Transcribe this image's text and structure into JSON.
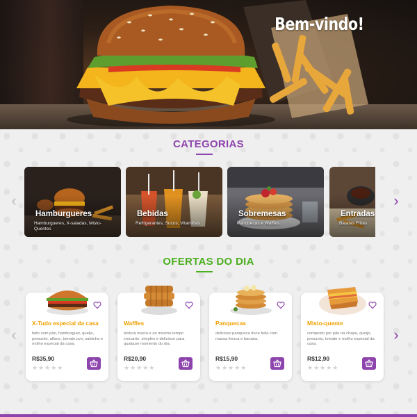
{
  "hero": {
    "title": "Bem-vindo!"
  },
  "categories": {
    "title": "CATEGORIAS",
    "items": [
      {
        "name": "Hamburgueres",
        "desc": "Hamburgueres, X-saladas, Misto-Quentes"
      },
      {
        "name": "Bebidas",
        "desc": "Refrigerantes, Sucos, Vitaminas"
      },
      {
        "name": "Sobremesas",
        "desc": "Panquecas e Waffles"
      },
      {
        "name": "Entradas",
        "desc": "Batatas Fritas"
      }
    ]
  },
  "offers": {
    "title": "OFERTAS DO DIA",
    "items": [
      {
        "title": "X-Tudo especial da casa",
        "desc": "feito com pão, hamburguer, queijo, presunto, alface, tomate,ovo, salsicha e molho especial da casa.",
        "price": "R$35,90"
      },
      {
        "title": "Waffles",
        "desc": "textura macia e ao mesmo tempo crocante. simples e delicioso para qualquer momento do dia.",
        "price": "R$20,90"
      },
      {
        "title": "Panquecas",
        "desc": "delicioso panqueca doce feita com massa fresca e banana.",
        "price": "R$15,90"
      },
      {
        "title": "Misto-quente",
        "desc": "composto por pão na chapa, queijo, presunto, tomate e molho especial da casa.",
        "price": "R$12,90"
      }
    ]
  },
  "icons": {
    "prev": "chevron-left-icon",
    "next": "chevron-right-icon",
    "favorite": "heart-icon",
    "cart": "basket-icon",
    "rating": "star-icon"
  },
  "colors": {
    "accent": "#8e44ad",
    "green": "#4caf1f",
    "price_title": "#f0a000"
  }
}
